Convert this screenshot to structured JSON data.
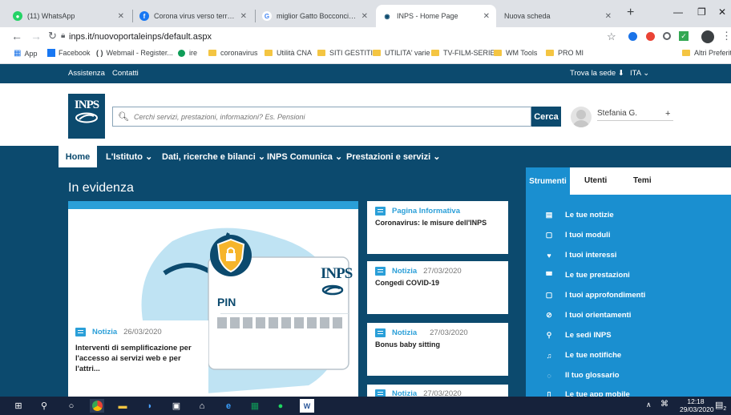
{
  "browser": {
    "tabs": [
      {
        "title": "(11) WhatsApp",
        "icon_color": "#25d366",
        "icon_text": "●"
      },
      {
        "title": "Corona virus verso terremoto...",
        "icon_color": "#1877f2",
        "icon_text": "f"
      },
      {
        "title": "miglior Gatto Bocconcini Pollo",
        "icon_color": "#4285f4",
        "icon_text": "G"
      },
      {
        "title": "INPS - Home Page",
        "icon_color": "#0c4a6e",
        "icon_text": "◉"
      },
      {
        "title": "Nuova scheda",
        "icon_color": "#dee1e6",
        "icon_text": ""
      }
    ],
    "url": "inps.it/nuovoportaleinps/default.aspx",
    "bookmarks": {
      "apps": "App",
      "items": [
        "Facebook",
        "Webmail - Register...",
        "ire",
        "coronavirus",
        "Utilità CNA",
        "SITI GESTITI",
        "UTILITA' varie",
        "TV-FILM-SERIE",
        "WM Tools",
        "PRO MI"
      ],
      "other": "Altri Preferiti"
    }
  },
  "inps": {
    "top_links": [
      "Assistenza",
      "Contatti"
    ],
    "trova_sede": "Trova la sede",
    "language": "ITA",
    "logo_text": "INPS",
    "search_placeholder": "Cerchi servizi, prestazioni, informazioni? Es. Pensioni",
    "search_button": "Cerca",
    "user_name": "Stefania G.",
    "user_plus": "+",
    "nav": {
      "home": "Home",
      "items": [
        "L'Istituto",
        "Dati, ricerche e bilanci",
        "INPS Comunica",
        "Prestazioni e servizi"
      ]
    },
    "section_title": "In evidenza",
    "pin_label": "PIN",
    "card_logo": "INPS",
    "featured": {
      "type": "Notizia",
      "date": "26/03/2020",
      "title": "Interventi di semplificazione per l'accesso ai servizi web e per l'attri..."
    },
    "side_cards": [
      {
        "type": "Pagina Informativa",
        "date": "",
        "title": "Coronavirus: le misure dell'INPS"
      },
      {
        "type": "Notizia",
        "date": "27/03/2020",
        "title": "Congedi COVID-19"
      },
      {
        "type": "Notizia",
        "date": "",
        "title": "Bonus baby sitting"
      },
      {
        "type": "Notizia",
        "date": "27/03/2020",
        "title": ""
      }
    ],
    "tool_tabs": [
      "Strumenti",
      "Utenti",
      "Temi"
    ],
    "tools": [
      {
        "label": "Le tue notizie",
        "icon": "news-icon"
      },
      {
        "label": "I tuoi moduli",
        "icon": "document-icon"
      },
      {
        "label": "I tuoi interessi",
        "icon": "heart-icon"
      },
      {
        "label": "Le tue prestazioni",
        "icon": "inbox-icon"
      },
      {
        "label": "I tuoi approfondimenti",
        "icon": "document-icon"
      },
      {
        "label": "I tuoi orientamenti",
        "icon": "compass-icon"
      },
      {
        "label": "Le sedi INPS",
        "icon": "pin-icon"
      },
      {
        "label": "Le tue notifiche",
        "icon": "bell-icon"
      },
      {
        "label": "Il tuo glossario",
        "icon": "chat-icon"
      },
      {
        "label": "Le tue app mobile",
        "icon": "mobile-icon"
      }
    ]
  },
  "taskbar": {
    "time": "12:18",
    "date": "29/03/2020",
    "notification_count": "2"
  },
  "colors": {
    "inps_dark": "#0c4a6e",
    "inps_light": "#1a8fd0",
    "taskbar": "#16223b"
  }
}
